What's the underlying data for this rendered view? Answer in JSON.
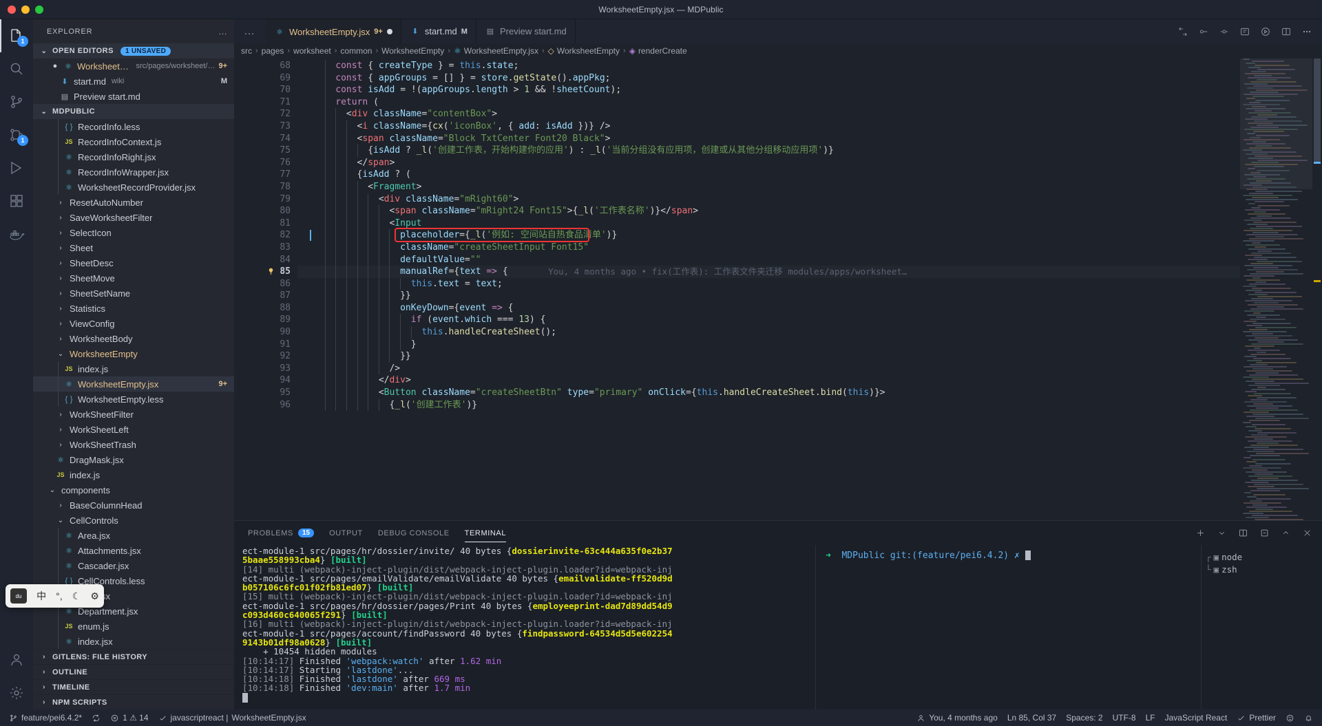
{
  "window": {
    "title": "WorksheetEmpty.jsx — MDPublic"
  },
  "activity_bar": {
    "items": [
      {
        "name": "explorer",
        "badge": "1",
        "active": true
      },
      {
        "name": "search",
        "badge": "",
        "active": false
      },
      {
        "name": "source-control",
        "badge": "",
        "active": false
      },
      {
        "name": "git-graph",
        "badge": "1",
        "active": false
      },
      {
        "name": "run-and-debug",
        "badge": "",
        "active": false
      },
      {
        "name": "extensions",
        "badge": "",
        "active": false
      },
      {
        "name": "docker",
        "badge": "",
        "active": false
      }
    ],
    "bottom": [
      {
        "name": "accounts",
        "badge": ""
      },
      {
        "name": "settings",
        "badge": ""
      }
    ]
  },
  "sidebar": {
    "title": "EXPLORER",
    "more_label": "…",
    "open_editors": {
      "label": "OPEN EDITORS",
      "badge": "1 UNSAVED",
      "items": [
        {
          "name": "WorksheetEmpty.jsx",
          "sub": "src/pages/worksheet/…",
          "right": "9+",
          "icon": "react-icon",
          "dirty": true,
          "color": "yellow"
        },
        {
          "name": "start.md",
          "sub": "wiki",
          "right": "M",
          "icon": "markdown-icon",
          "dirty": false,
          "color": "normal"
        },
        {
          "name": "Preview start.md",
          "sub": "",
          "right": "",
          "icon": "preview-icon",
          "dirty": false,
          "color": "dim"
        }
      ]
    },
    "project": {
      "label": "MDPUBLIC",
      "items": [
        {
          "label": "RecordInfo.less",
          "indent": 3,
          "icon": "less-icon",
          "kind": "file"
        },
        {
          "label": "RecordInfoContext.js",
          "indent": 3,
          "icon": "js-icon",
          "kind": "file"
        },
        {
          "label": "RecordInfoRight.jsx",
          "indent": 3,
          "icon": "react-icon",
          "kind": "file"
        },
        {
          "label": "RecordInfoWrapper.jsx",
          "indent": 3,
          "icon": "react-icon",
          "kind": "file"
        },
        {
          "label": "WorksheetRecordProvider.jsx",
          "indent": 3,
          "icon": "react-icon",
          "kind": "file"
        },
        {
          "label": "ResetAutoNumber",
          "indent": 2,
          "icon": "chevron-right-icon",
          "kind": "folder"
        },
        {
          "label": "SaveWorksheetFilter",
          "indent": 2,
          "icon": "chevron-right-icon",
          "kind": "folder"
        },
        {
          "label": "SelectIcon",
          "indent": 2,
          "icon": "chevron-right-icon",
          "kind": "folder"
        },
        {
          "label": "Sheet",
          "indent": 2,
          "icon": "chevron-right-icon",
          "kind": "folder"
        },
        {
          "label": "SheetDesc",
          "indent": 2,
          "icon": "chevron-right-icon",
          "kind": "folder"
        },
        {
          "label": "SheetMove",
          "indent": 2,
          "icon": "chevron-right-icon",
          "kind": "folder"
        },
        {
          "label": "SheetSetName",
          "indent": 2,
          "icon": "chevron-right-icon",
          "kind": "folder"
        },
        {
          "label": "Statistics",
          "indent": 2,
          "icon": "chevron-right-icon",
          "kind": "folder"
        },
        {
          "label": "ViewConfig",
          "indent": 2,
          "icon": "chevron-right-icon",
          "kind": "folder"
        },
        {
          "label": "WorksheetBody",
          "indent": 2,
          "icon": "chevron-right-icon",
          "kind": "folder"
        },
        {
          "label": "WorksheetEmpty",
          "indent": 2,
          "icon": "chevron-down-icon",
          "kind": "folder",
          "color": "yellow",
          "expanded": true
        },
        {
          "label": "index.js",
          "indent": 3,
          "icon": "js-icon",
          "kind": "file"
        },
        {
          "label": "WorksheetEmpty.jsx",
          "indent": 3,
          "icon": "react-icon",
          "kind": "file",
          "color": "yellow",
          "selected": true,
          "right": "9+"
        },
        {
          "label": "WorksheetEmpty.less",
          "indent": 3,
          "icon": "less-icon",
          "kind": "file"
        },
        {
          "label": "WorkSheetFilter",
          "indent": 2,
          "icon": "chevron-right-icon",
          "kind": "folder"
        },
        {
          "label": "WorkSheetLeft",
          "indent": 2,
          "icon": "chevron-right-icon",
          "kind": "folder"
        },
        {
          "label": "WorkSheetTrash",
          "indent": 2,
          "icon": "chevron-right-icon",
          "kind": "folder"
        },
        {
          "label": "DragMask.jsx",
          "indent": 2,
          "icon": "react-icon",
          "kind": "file"
        },
        {
          "label": "index.js",
          "indent": 2,
          "icon": "js-icon",
          "kind": "file"
        },
        {
          "label": "components",
          "indent": 1,
          "icon": "chevron-down-icon",
          "kind": "folder",
          "expanded": true
        },
        {
          "label": "BaseColumnHead",
          "indent": 2,
          "icon": "chevron-right-icon",
          "kind": "folder"
        },
        {
          "label": "CellControls",
          "indent": 2,
          "icon": "chevron-down-icon",
          "kind": "folder",
          "expanded": true
        },
        {
          "label": "Area.jsx",
          "indent": 3,
          "icon": "react-icon",
          "kind": "file"
        },
        {
          "label": "Attachments.jsx",
          "indent": 3,
          "icon": "react-icon",
          "kind": "file"
        },
        {
          "label": "Cascader.jsx",
          "indent": 3,
          "icon": "react-icon",
          "kind": "file"
        },
        {
          "label": "CellControls.less",
          "indent": 3,
          "icon": "less-icon",
          "kind": "file"
        },
        {
          "label": "Date.jsx",
          "indent": 3,
          "icon": "react-icon",
          "kind": "file"
        },
        {
          "label": "Department.jsx",
          "indent": 3,
          "icon": "react-icon",
          "kind": "file"
        },
        {
          "label": "enum.js",
          "indent": 3,
          "icon": "js-icon",
          "kind": "file"
        },
        {
          "label": "index.jsx",
          "indent": 3,
          "icon": "react-icon",
          "kind": "file"
        }
      ]
    },
    "bottom_sections": [
      {
        "label": "GITLENS: FILE HISTORY"
      },
      {
        "label": "OUTLINE"
      },
      {
        "label": "TIMELINE"
      },
      {
        "label": "NPM SCRIPTS"
      }
    ]
  },
  "tabs": [
    {
      "label": "WorksheetEmpty.jsx",
      "count": "9+",
      "icon": "react-icon",
      "dirty": true,
      "active": true
    },
    {
      "label": "start.md",
      "count": "M",
      "icon": "markdown-icon",
      "dirty": false,
      "active": false
    },
    {
      "label": "Preview start.md",
      "count": "",
      "icon": "preview-icon",
      "dirty": false,
      "active": false
    }
  ],
  "breadcrumb": [
    {
      "label": "src",
      "icon": ""
    },
    {
      "label": "pages",
      "icon": ""
    },
    {
      "label": "worksheet",
      "icon": ""
    },
    {
      "label": "common",
      "icon": ""
    },
    {
      "label": "WorksheetEmpty",
      "icon": ""
    },
    {
      "label": "WorksheetEmpty.jsx",
      "icon": "react-icon"
    },
    {
      "label": "WorksheetEmpty",
      "icon": "class-icon"
    },
    {
      "label": "renderCreate",
      "icon": "method-icon"
    }
  ],
  "editor": {
    "first_line": 68,
    "current_line": 85,
    "cursor_line": 82,
    "blame": "You, 4 months ago • fix(工作表): 工作表文件夹迁移 modules/apps/worksheet…",
    "lines": [
      {
        "n": 68,
        "indent": 2
      },
      {
        "n": 69,
        "indent": 2
      },
      {
        "n": 70,
        "indent": 2
      },
      {
        "n": 71,
        "indent": 2
      },
      {
        "n": 72,
        "indent": 3
      },
      {
        "n": 73,
        "indent": 4
      },
      {
        "n": 74,
        "indent": 4
      },
      {
        "n": 75,
        "indent": 5
      },
      {
        "n": 76,
        "indent": 4
      },
      {
        "n": 77,
        "indent": 4
      },
      {
        "n": 78,
        "indent": 5
      },
      {
        "n": 79,
        "indent": 6
      },
      {
        "n": 80,
        "indent": 7
      },
      {
        "n": 81,
        "indent": 7
      },
      {
        "n": 82,
        "indent": 8
      },
      {
        "n": 83,
        "indent": 8
      },
      {
        "n": 84,
        "indent": 8
      },
      {
        "n": 85,
        "indent": 8
      },
      {
        "n": 86,
        "indent": 9
      },
      {
        "n": 87,
        "indent": 8
      },
      {
        "n": 88,
        "indent": 8
      },
      {
        "n": 89,
        "indent": 9
      },
      {
        "n": 90,
        "indent": 10
      },
      {
        "n": 91,
        "indent": 9
      },
      {
        "n": 92,
        "indent": 8
      },
      {
        "n": 93,
        "indent": 7
      },
      {
        "n": 94,
        "indent": 6
      },
      {
        "n": 95,
        "indent": 6
      },
      {
        "n": 96,
        "indent": 7
      }
    ],
    "highlight_box_label": "placeholder={_l('例如: 空间站自热食品清单')}"
  },
  "panel": {
    "tabs": [
      {
        "label": "PROBLEMS",
        "badge": "15",
        "active": false
      },
      {
        "label": "OUTPUT",
        "badge": "",
        "active": false
      },
      {
        "label": "DEBUG CONSOLE",
        "badge": "",
        "active": false
      },
      {
        "label": "TERMINAL",
        "badge": "",
        "active": true
      }
    ],
    "terminal_prompt": "MDPublic git:(feature/pei6.4.2) ✗",
    "terminal_list": [
      {
        "label": "node",
        "icon": "terminal-icon"
      },
      {
        "label": "zsh",
        "icon": "terminal-icon"
      }
    ],
    "terminal_output": [
      {
        "text": "ect-module-1 src/pages/hr/dossier/invite/ 40 bytes {",
        "cls": "w"
      },
      {
        "text": "dossierinvite-63c444a635f0e2b37",
        "cls": "y"
      },
      {
        "text": "5baae558993cba4",
        "cls": "y"
      },
      {
        "text": "} ",
        "cls": "w"
      },
      {
        "text": "[built]",
        "cls": "g"
      }
    ]
  },
  "status_bar": {
    "left": [
      {
        "name": "remote-branch",
        "label": "feature/pei6.4.2*",
        "icon": "branch-icon"
      },
      {
        "name": "sync",
        "label": "",
        "icon": "sync-icon"
      },
      {
        "name": "problems",
        "label": "1 ⚠ 14",
        "icon": "error-icon"
      },
      {
        "name": "javascript-react-status",
        "label": "javascriptreact |",
        "icon": "check-icon"
      },
      {
        "name": "active-file",
        "label": "WorksheetEmpty.jsx",
        "icon": ""
      }
    ],
    "right": [
      {
        "name": "git-blame",
        "label": "You, 4 months ago",
        "icon": "person-icon"
      },
      {
        "name": "cursor-position",
        "label": "Ln 85, Col 37",
        "icon": ""
      },
      {
        "name": "indentation",
        "label": "Spaces: 2",
        "icon": ""
      },
      {
        "name": "encoding",
        "label": "UTF-8",
        "icon": ""
      },
      {
        "name": "eol",
        "label": "LF",
        "icon": ""
      },
      {
        "name": "language-mode",
        "label": "JavaScript React",
        "icon": ""
      },
      {
        "name": "prettier",
        "label": "Prettier",
        "icon": "check-icon"
      },
      {
        "name": "notifications",
        "label": "",
        "icon": "bell-icon"
      }
    ]
  },
  "ime_overlay": {
    "items": [
      "中",
      "°,",
      "☾",
      "⚙"
    ]
  }
}
